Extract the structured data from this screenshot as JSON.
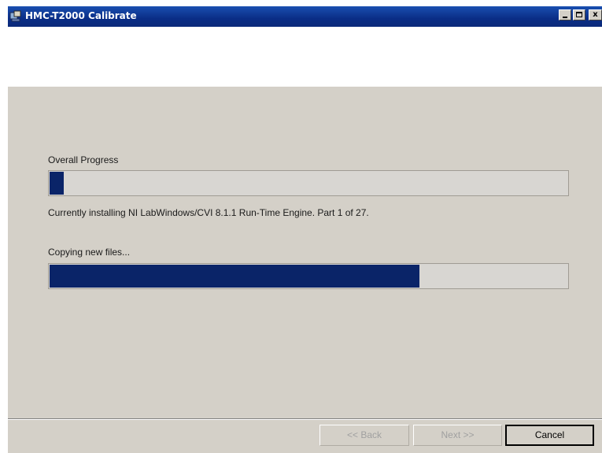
{
  "window": {
    "title": "HMC-T2000 Calibrate",
    "app_icon": "installer-icon"
  },
  "controls": {
    "minimize_icon": "minimize-icon",
    "maximize_icon": "maximize-icon",
    "close_label": "x"
  },
  "overall": {
    "label": "Overall Progress",
    "progress": 0.03,
    "status": "Currently installing NI LabWindows/CVI 8.1.1 Run-Time Engine.  Part 1 of 27."
  },
  "current": {
    "label": "Copying new files...",
    "progress": 0.715
  },
  "buttons": {
    "back_label": "<< Back",
    "next_label": "Next >>",
    "cancel_label": "Cancel"
  },
  "colors": {
    "title_bar": "#0a2d86",
    "progress_fill": "#0a2468",
    "dialog_bg": "#d4d0c8"
  }
}
